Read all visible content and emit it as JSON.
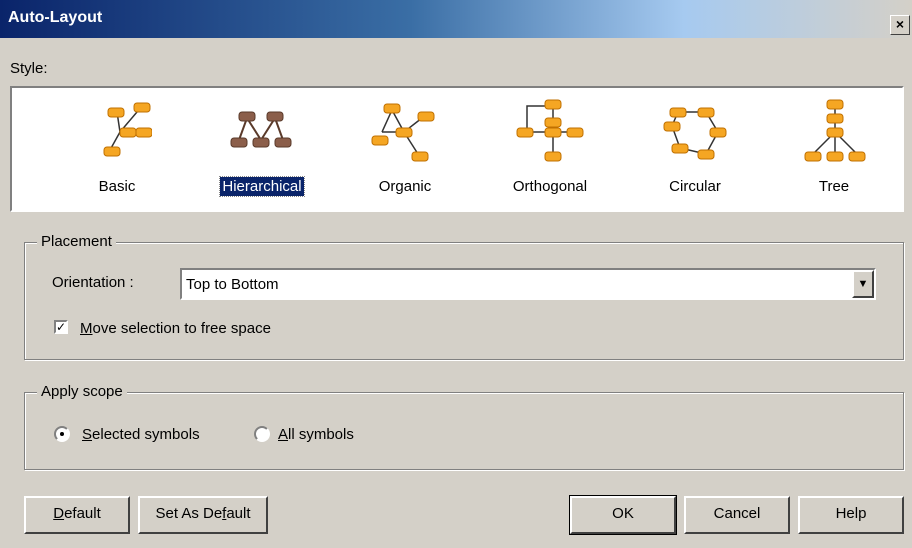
{
  "window": {
    "title": "Auto-Layout",
    "close_glyph": "×"
  },
  "style_label": "Style:",
  "styles": [
    {
      "label": "Basic",
      "icon": "basic-layout-icon",
      "selected": false
    },
    {
      "label": "Hierarchical",
      "icon": "hierarchical-layout-icon",
      "selected": true
    },
    {
      "label": "Organic",
      "icon": "organic-layout-icon",
      "selected": false
    },
    {
      "label": "Orthogonal",
      "icon": "orthogonal-layout-icon",
      "selected": false
    },
    {
      "label": "Circular",
      "icon": "circular-layout-icon",
      "selected": false
    },
    {
      "label": "Tree",
      "icon": "tree-layout-icon",
      "selected": false
    }
  ],
  "placement": {
    "title": "Placement",
    "orientation_label": "Orientation :",
    "orientation_value": "Top to Bottom",
    "move_selection": {
      "first": "M",
      "rest": "ove selection to free space",
      "checked": true
    }
  },
  "scope": {
    "title": "Apply scope",
    "selected": {
      "first": "S",
      "rest": "elected symbols",
      "checked": true
    },
    "all": {
      "first": "A",
      "rest": "ll symbols",
      "checked": false
    }
  },
  "buttons": {
    "default": {
      "first": "D",
      "rest": "efault"
    },
    "set_default": {
      "pre": "Set As De",
      "u": "f",
      "post": "ault"
    },
    "ok": "OK",
    "cancel": "Cancel",
    "help": "Help"
  },
  "colors": {
    "node": "#f5a623",
    "node_selected_style": "#8b5e4a",
    "selection": "#0a246a"
  }
}
